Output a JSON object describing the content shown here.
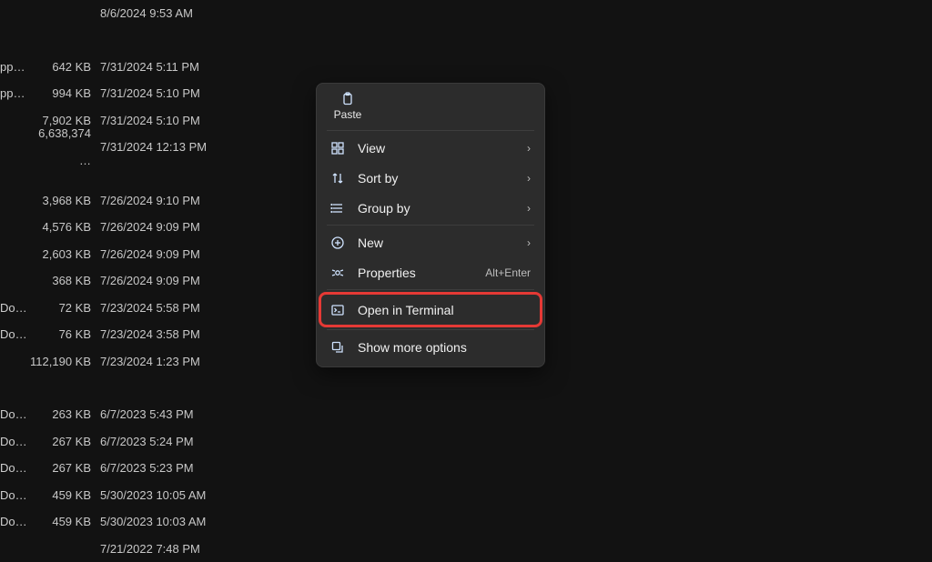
{
  "files": [
    {
      "name": "",
      "size": "",
      "date": "8/6/2024 9:53 AM"
    },
    {
      "blank": true
    },
    {
      "name": "pp…",
      "size": "642 KB",
      "date": "7/31/2024 5:11 PM"
    },
    {
      "name": "pp…",
      "size": "994 KB",
      "date": "7/31/2024 5:10 PM"
    },
    {
      "name": "",
      "size": "7,902 KB",
      "date": "7/31/2024 5:10 PM"
    },
    {
      "name": "",
      "size": "6,638,374 …",
      "date": "7/31/2024 12:13 PM"
    },
    {
      "blank": true
    },
    {
      "name": "",
      "size": "3,968 KB",
      "date": "7/26/2024 9:10 PM"
    },
    {
      "name": "",
      "size": "4,576 KB",
      "date": "7/26/2024 9:09 PM"
    },
    {
      "name": "",
      "size": "2,603 KB",
      "date": "7/26/2024 9:09 PM"
    },
    {
      "name": "",
      "size": "368 KB",
      "date": "7/26/2024 9:09 PM"
    },
    {
      "name": "Do…",
      "size": "72 KB",
      "date": "7/23/2024 5:58 PM"
    },
    {
      "name": "Do…",
      "size": "76 KB",
      "date": "7/23/2024 3:58 PM"
    },
    {
      "name": "",
      "size": "112,190 KB",
      "date": "7/23/2024 1:23 PM"
    },
    {
      "blank": true
    },
    {
      "name": "Do…",
      "size": "263 KB",
      "date": "6/7/2023 5:43 PM"
    },
    {
      "name": "Do…",
      "size": "267 KB",
      "date": "6/7/2023 5:24 PM"
    },
    {
      "name": "Do…",
      "size": "267 KB",
      "date": "6/7/2023 5:23 PM"
    },
    {
      "name": "Do…",
      "size": "459 KB",
      "date": "5/30/2023 10:05 AM"
    },
    {
      "name": "Do…",
      "size": "459 KB",
      "date": "5/30/2023 10:03 AM"
    },
    {
      "name": "",
      "size": "",
      "date": "7/21/2022 7:48 PM"
    }
  ],
  "menu": {
    "paste": "Paste",
    "view": "View",
    "sort": "Sort by",
    "group": "Group by",
    "new": "New",
    "properties": "Properties",
    "properties_shortcut": "Alt+Enter",
    "open_terminal": "Open in Terminal",
    "more": "Show more options",
    "chevron": "›"
  }
}
